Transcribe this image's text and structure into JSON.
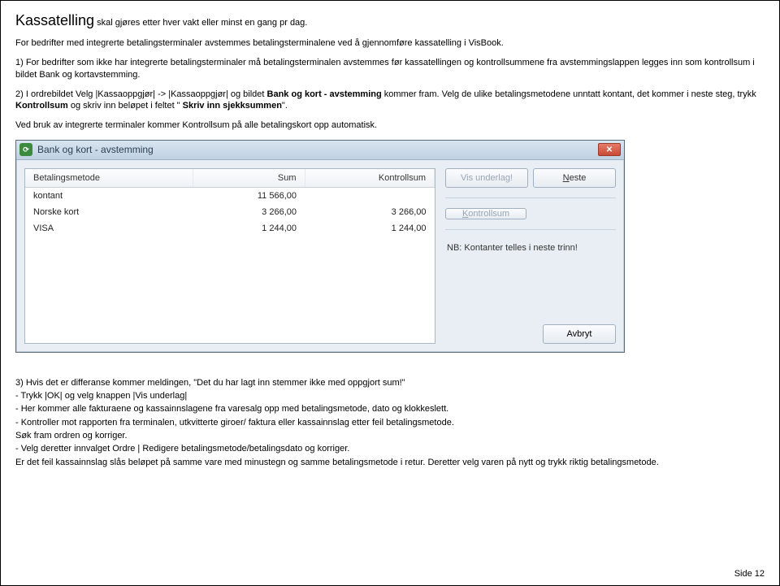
{
  "title": {
    "main": "Kassatelling",
    "sub": " skal gjøres etter hver vakt eller minst en gang pr dag."
  },
  "p1": "For bedrifter med integrerte betalingsterminaler avstemmes betalingsterminalene ved å gjennomføre kassatelling i VisBook.",
  "p2": "1) For bedrifter som ikke har integrerte betalingsterminaler må betalingsterminalen avstemmes før kassatellingen og kontrollsummene fra avstemmingslappen legges inn som kontrollsum i bildet Bank og kortavstemming.",
  "p3a": "2) I ordrebildet Velg |Kassaoppgjør| -> |Kassaoppgjør| og bildet ",
  "p3b": "Bank og kort - avstemming",
  "p3c": " kommer fram. Velg de ulike betalingsmetodene unntatt kontant, det kommer i neste steg, trykk ",
  "p3d": "Kontrollsum",
  "p3e": " og skriv inn beløpet i feltet \" ",
  "p3f": "Skriv inn sjekksummen",
  "p3g": "\".",
  "p4": "Ved bruk av integrerte terminaler kommer Kontrollsum på alle betalingskort opp automatisk.",
  "window": {
    "title": "Bank og kort - avstemming",
    "headers": {
      "method": "Betalingsmetode",
      "sum": "Sum",
      "control": "Kontrollsum"
    },
    "rows": [
      {
        "method": "kontant",
        "sum": "11 566,00",
        "control": ""
      },
      {
        "method": "Norske kort",
        "sum": "3 266,00",
        "control": "3 266,00"
      },
      {
        "method": "VISA",
        "sum": "1 244,00",
        "control": "1 244,00"
      }
    ],
    "buttons": {
      "vis": "Vis underlag!",
      "neste_pre": "N",
      "neste_rest": "este",
      "kontrollsum_pre": "K",
      "kontrollsum_rest": "ontrollsum",
      "avbryt_pre": "A",
      "avbryt_rest": "vbryt"
    },
    "note": "NB: Kontanter telles i neste trinn!"
  },
  "p5": "3) Hvis det er differanse kommer meldingen, \"Det du har lagt inn stemmer ikke med oppgjort sum!\"",
  "p6": "- Trykk |OK| og velg knappen |Vis underlag|",
  "p7": "- Her kommer alle fakturaene og kassainnslagene fra varesalg opp med betalingsmetode, dato og klokkeslett.",
  "p8": "- Kontroller mot rapporten fra terminalen, utkvitterte giroer/ faktura eller kassainnslag etter feil betalingsmetode.",
  "p9": "Søk fram ordren og korriger.",
  "p10": "- Velg deretter innvalget Ordre |  Redigere betalingsmetode/betalingsdato og korriger.",
  "p11": "Er det feil kassainnslag slås beløpet på samme vare med minustegn og samme betalingsmetode i retur. Deretter velg varen på nytt og trykk riktig betalingsmetode.",
  "page": "Side 12"
}
